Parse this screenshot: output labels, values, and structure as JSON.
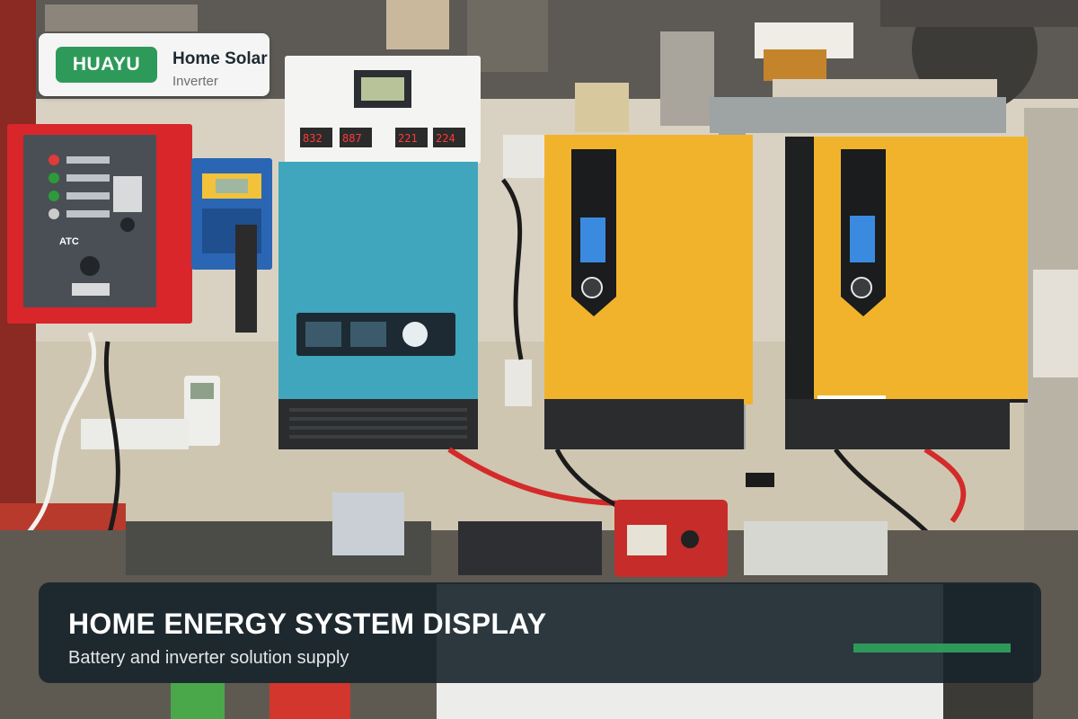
{
  "brand": {
    "logo_text": "HUAYU",
    "title": "Home Solar",
    "subtitle": "Inverter"
  },
  "caption": {
    "title": "HOME ENERGY SYSTEM DISPLAY",
    "subtitle": "Battery and inverter solution supply"
  },
  "photo_labels": {
    "ats_label": "ATC",
    "meter_readings": [
      "832",
      "887",
      "221",
      "224"
    ]
  },
  "colors": {
    "brand_green": "#2e9a5a",
    "caption_bg": "#17232b",
    "inverter_blue": "#3fa6bd",
    "inverter_yellow": "#f2b32c",
    "ats_red": "#d8262b"
  }
}
